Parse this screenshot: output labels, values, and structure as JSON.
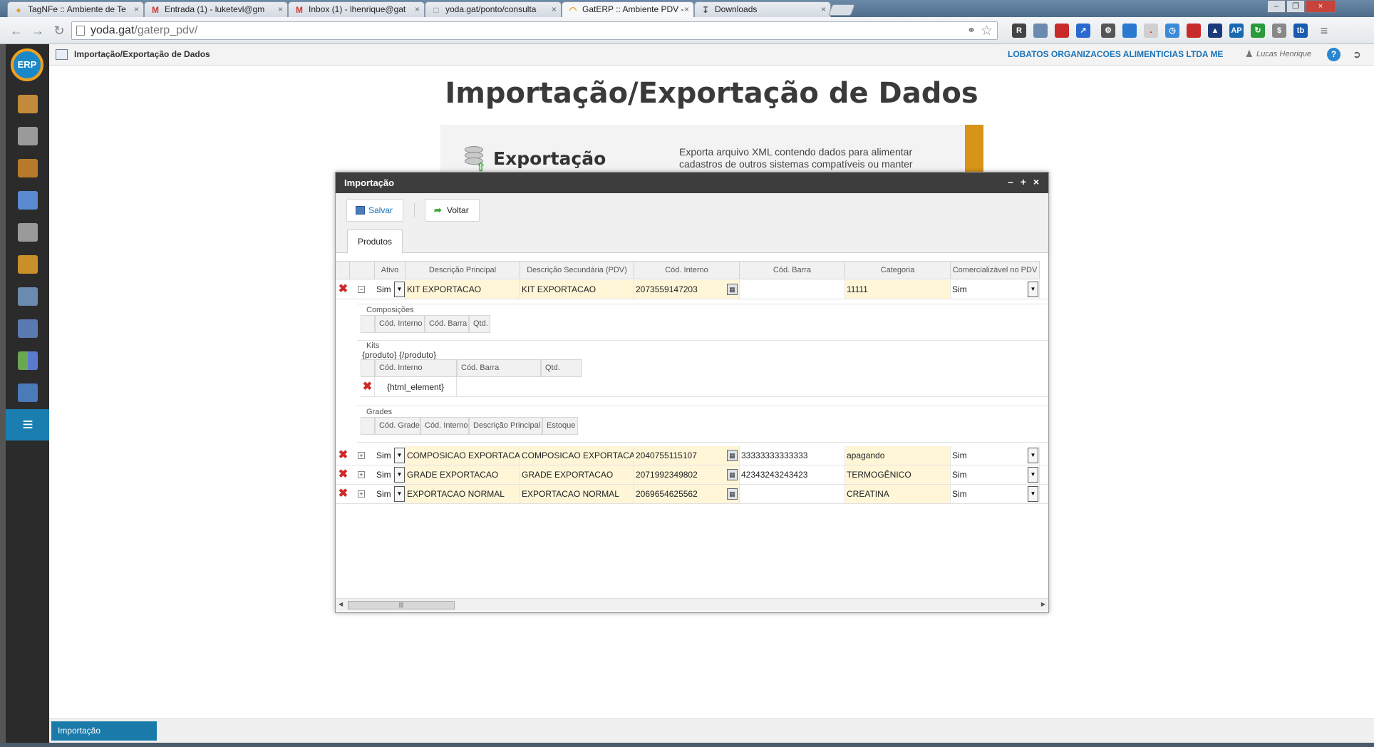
{
  "browser": {
    "tabs": [
      {
        "label": "TagNFe :: Ambiente de Te",
        "icon": "lock-icon",
        "color": "#e8a020"
      },
      {
        "label": "Entrada (1) - luketevl@gm",
        "icon": "gmail-icon",
        "color": "#d0382c"
      },
      {
        "label": "Inbox (1) - lhenrique@gat",
        "icon": "gmail-icon",
        "color": "#d0382c"
      },
      {
        "label": "yoda.gat/ponto/consulta",
        "icon": "page-icon",
        "color": "#888888"
      },
      {
        "label": "GatERP :: Ambiente PDV - ",
        "icon": "loading-icon",
        "color": "#e8a020"
      },
      {
        "label": "Downloads",
        "icon": "download-icon",
        "color": "#555555"
      }
    ],
    "url_host": "yoda.gat",
    "url_path": "/gaterp_pdv/"
  },
  "app": {
    "header_title": "Importação/Exportação de Dados",
    "company": "LOBATOS ORGANIZACOES ALIMENTICIAS LTDA ME",
    "user": "Lucas Henrique",
    "help": "?",
    "logo": "ERP",
    "sidebar": [
      {
        "name": "home-icon",
        "color": "#c28a3a"
      },
      {
        "name": "cart-icon",
        "color": "#9a9a9a"
      },
      {
        "name": "box-icon",
        "color": "#b77a2a"
      },
      {
        "name": "users-icon",
        "color": "#5a8ad0"
      },
      {
        "name": "cart-tools-icon",
        "color": "#9a9a9a"
      },
      {
        "name": "truck-icon",
        "color": "#c9902a"
      },
      {
        "name": "report-search-icon",
        "color": "#6a8ab0"
      },
      {
        "name": "calendar-icon",
        "color": "#5a7ab0"
      },
      {
        "name": "modules-icon",
        "color": "#6aa850"
      },
      {
        "name": "register-icon",
        "color": "#4a7ab8"
      },
      {
        "name": "list-icon",
        "color": "#ffffff"
      }
    ]
  },
  "page": {
    "title": "Importação/Exportação de Dados",
    "export_card": {
      "heading": "Exportação",
      "description": "Exporta arquivo XML contendo dados para alimentar cadastros de outros sistemas compatíveis ou manter"
    }
  },
  "modal": {
    "title": "Importação",
    "controls": [
      "–",
      "+",
      "×"
    ],
    "buttons": {
      "save": "Salvar",
      "back": "Voltar"
    },
    "tab": "Produtos",
    "columns": [
      "Ativo",
      "Descrição Principal",
      "Descrição Secundária (PDV)",
      "Cód. Interno",
      "Cód. Barra",
      "Categoria",
      "Comercializável no PDV"
    ],
    "rows": [
      {
        "ativo": "Sim",
        "desc": "KIT EXPORTACAO",
        "desc2": "KIT EXPORTACAO",
        "cod": "2073559147203",
        "barra": "",
        "categoria": "11111",
        "pdv": "Sim",
        "expander": "−"
      },
      {
        "ativo": "Sim",
        "desc": "COMPOSICAO EXPORTACAO",
        "desc2": "COMPOSICAO EXPORTACAO",
        "cod": "2040755115107",
        "barra": "33333333333333",
        "categoria": "apagando",
        "pdv": "Sim",
        "expander": "+"
      },
      {
        "ativo": "Sim",
        "desc": "GRADE EXPORTACAO",
        "desc2": "GRADE EXPORTACAO",
        "cod": "2071992349802",
        "barra": "42343243243423",
        "categoria": "TERMOGÊNICO",
        "pdv": "Sim",
        "expander": "+"
      },
      {
        "ativo": "Sim",
        "desc": "EXPORTACAO NORMAL",
        "desc2": "EXPORTACAO NORMAL",
        "cod": "2069654625562",
        "barra": "",
        "categoria": "CREATINA",
        "pdv": "Sim",
        "expander": "+"
      }
    ],
    "detail": {
      "composicoes": {
        "label": "Composições",
        "columns": [
          "Cód. Interno",
          "Cód. Barra",
          "Qtd."
        ]
      },
      "kits": {
        "label": "Kits",
        "template": "{produto} {/produto}",
        "columns": [
          "Cód. Interno",
          "Cód. Barra",
          "Qtd."
        ],
        "cell": "{html_element}"
      },
      "grades": {
        "label": "Grades",
        "columns": [
          "Cód. Grade",
          "Cód. Interno",
          "Descrição Principal",
          "Estoque"
        ]
      }
    }
  },
  "footer": {
    "task": "Importação"
  }
}
